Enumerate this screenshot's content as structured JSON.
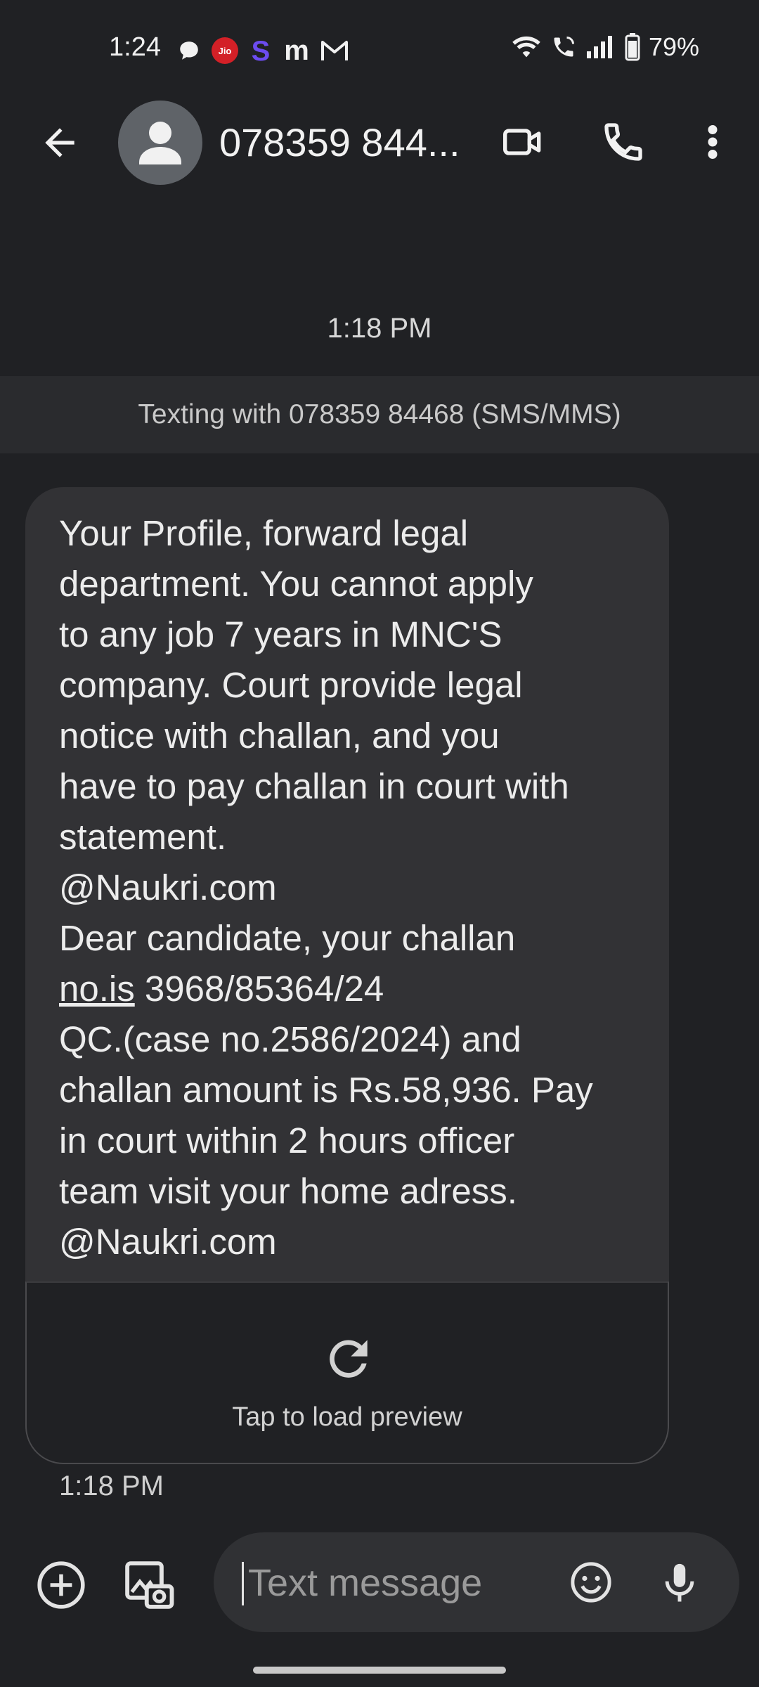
{
  "status_bar": {
    "time": "1:24",
    "battery_percent": "79%",
    "left_icons": [
      "chat-bubble-icon",
      "jio-icon",
      "s-app-icon",
      "m-app-icon",
      "gmail-icon"
    ],
    "right_icons": [
      "wifi-icon",
      "wifi-calling-icon",
      "signal-icon",
      "battery-icon"
    ]
  },
  "header": {
    "contact_name": "078359 844...",
    "icons": [
      "back-arrow-icon",
      "avatar-icon",
      "video-call-icon",
      "phone-icon",
      "more-vert-icon"
    ]
  },
  "conversation": {
    "date_separator": "1:18 PM",
    "texting_info": "Texting with 078359 84468 (SMS/MMS)",
    "message": {
      "part1": "Your Profile, forward legal\ndepartment. You cannot apply\nto any job 7 years in MNC'S\ncompany. Court provide legal\nnotice with challan, and you\nhave to pay challan in court with\nstatement.\n@Naukri.com\nDear candidate, your challan\n",
      "link_text": "no.is",
      "part2": " 3968/85364/24\nQC.(case no.2586/2024) and\nchallan amount is Rs.58,936. Pay\nin court within 2 hours officer\nteam visit your home adress.\n@Naukri.com",
      "preview_label": "Tap to load preview",
      "timestamp": "1:18 PM"
    }
  },
  "compose": {
    "placeholder": "Text message",
    "icons": [
      "add-icon",
      "gallery-icon",
      "emoji-icon",
      "mic-icon"
    ]
  },
  "colors": {
    "background": "#202124",
    "bubble": "#323235",
    "compose": "#303134"
  }
}
